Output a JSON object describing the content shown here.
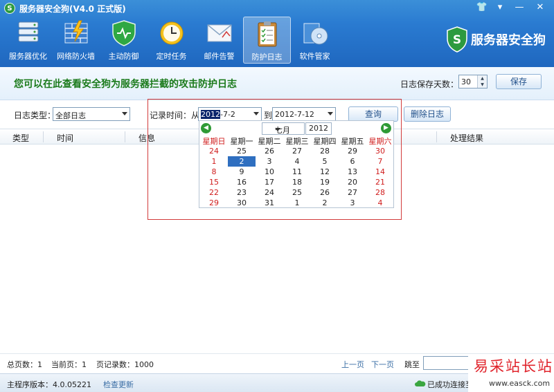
{
  "window": {
    "title": "服务器安全狗(V4.0 正式版)",
    "controls": [
      "skin-icon",
      "menu-icon",
      "minimize-icon",
      "close-icon"
    ]
  },
  "toolbar": {
    "items": [
      {
        "label": "服务器优化",
        "icon": "server-optimize-icon"
      },
      {
        "label": "网络防火墙",
        "icon": "firewall-icon"
      },
      {
        "label": "主动防御",
        "icon": "shield-icon"
      },
      {
        "label": "定时任务",
        "icon": "clock-icon"
      },
      {
        "label": "邮件告警",
        "icon": "mail-icon"
      },
      {
        "label": "防护日志",
        "icon": "clipboard-icon",
        "active": true
      },
      {
        "label": "软件管家",
        "icon": "software-disc-icon"
      }
    ]
  },
  "brand": {
    "text": "服务器安全狗",
    "logo_letter": "S"
  },
  "header": {
    "headline": "您可以在此查看安全狗为服务器拦截的攻击防护日志",
    "keep_days_label": "日志保存天数：",
    "keep_days_value": "30",
    "save_label": "保存"
  },
  "filters": {
    "type_label": "日志类型：",
    "type_value": "全部日志",
    "time_label": "记录时间：从",
    "from_year_selected": "2012",
    "from_rest": "-7-2",
    "to_label": "到",
    "to_value": "2012-7-12",
    "query_label": "查询",
    "delete_label": "删除日志"
  },
  "table": {
    "columns": [
      "类型",
      "时间",
      "信息",
      "处理结果"
    ]
  },
  "calendar": {
    "month": "七月",
    "year": "2012",
    "weekdays": [
      "星期日",
      "星期一",
      "星期二",
      "星期三",
      "星期四",
      "星期五",
      "星期六"
    ],
    "weeks": [
      [
        "24",
        "25",
        "26",
        "27",
        "28",
        "29",
        "30"
      ],
      [
        "1",
        "2",
        "3",
        "4",
        "5",
        "6",
        "7"
      ],
      [
        "8",
        "9",
        "10",
        "11",
        "12",
        "13",
        "14"
      ],
      [
        "15",
        "16",
        "17",
        "18",
        "19",
        "20",
        "21"
      ],
      [
        "22",
        "23",
        "24",
        "25",
        "26",
        "27",
        "28"
      ],
      [
        "29",
        "30",
        "31",
        "1",
        "2",
        "3",
        "4"
      ]
    ],
    "selected_day": "2"
  },
  "pager": {
    "total_pages": "总页数：1",
    "current_page": "当前页：1",
    "records_per_page": "页记录数：1000",
    "prev": "上一页",
    "next": "下一页",
    "goto": "跳至"
  },
  "status": {
    "version": "主程序版本：4.0.05221",
    "check_update": "检查更新",
    "connection": "已成功连接至"
  },
  "watermark": {
    "title": "易采站长站",
    "url": "www.easck.com"
  },
  "colors": {
    "toolbar_top": "#3b8fd8",
    "toolbar_bottom": "#1f67bf",
    "headline": "#1a7a1a",
    "weekend": "#d01d1d",
    "selected_day": "#2f6fc0",
    "highlight_frame": "#d23a3a"
  }
}
